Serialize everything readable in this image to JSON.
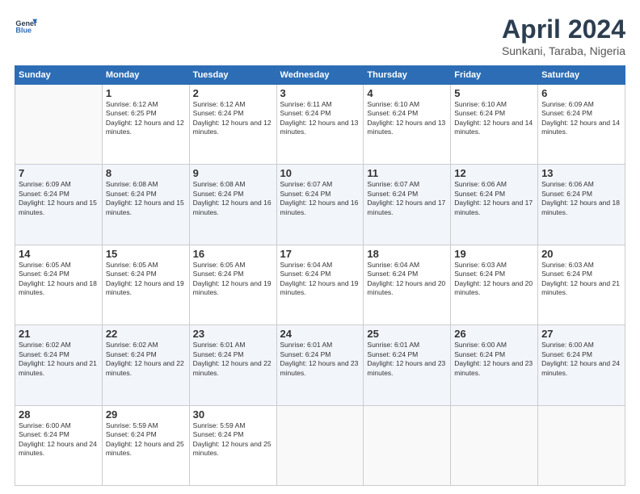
{
  "logo": {
    "text_line1": "General",
    "text_line2": "Blue"
  },
  "header": {
    "month": "April 2024",
    "location": "Sunkani, Taraba, Nigeria"
  },
  "weekdays": [
    "Sunday",
    "Monday",
    "Tuesday",
    "Wednesday",
    "Thursday",
    "Friday",
    "Saturday"
  ],
  "weeks": [
    [
      {
        "day": null
      },
      {
        "day": "1",
        "sunrise": "6:12 AM",
        "sunset": "6:25 PM",
        "daylight": "12 hours and 12 minutes."
      },
      {
        "day": "2",
        "sunrise": "6:12 AM",
        "sunset": "6:24 PM",
        "daylight": "12 hours and 12 minutes."
      },
      {
        "day": "3",
        "sunrise": "6:11 AM",
        "sunset": "6:24 PM",
        "daylight": "12 hours and 13 minutes."
      },
      {
        "day": "4",
        "sunrise": "6:10 AM",
        "sunset": "6:24 PM",
        "daylight": "12 hours and 13 minutes."
      },
      {
        "day": "5",
        "sunrise": "6:10 AM",
        "sunset": "6:24 PM",
        "daylight": "12 hours and 14 minutes."
      },
      {
        "day": "6",
        "sunrise": "6:09 AM",
        "sunset": "6:24 PM",
        "daylight": "12 hours and 14 minutes."
      }
    ],
    [
      {
        "day": "7",
        "sunrise": "6:09 AM",
        "sunset": "6:24 PM",
        "daylight": "12 hours and 15 minutes."
      },
      {
        "day": "8",
        "sunrise": "6:08 AM",
        "sunset": "6:24 PM",
        "daylight": "12 hours and 15 minutes."
      },
      {
        "day": "9",
        "sunrise": "6:08 AM",
        "sunset": "6:24 PM",
        "daylight": "12 hours and 16 minutes."
      },
      {
        "day": "10",
        "sunrise": "6:07 AM",
        "sunset": "6:24 PM",
        "daylight": "12 hours and 16 minutes."
      },
      {
        "day": "11",
        "sunrise": "6:07 AM",
        "sunset": "6:24 PM",
        "daylight": "12 hours and 17 minutes."
      },
      {
        "day": "12",
        "sunrise": "6:06 AM",
        "sunset": "6:24 PM",
        "daylight": "12 hours and 17 minutes."
      },
      {
        "day": "13",
        "sunrise": "6:06 AM",
        "sunset": "6:24 PM",
        "daylight": "12 hours and 18 minutes."
      }
    ],
    [
      {
        "day": "14",
        "sunrise": "6:05 AM",
        "sunset": "6:24 PM",
        "daylight": "12 hours and 18 minutes."
      },
      {
        "day": "15",
        "sunrise": "6:05 AM",
        "sunset": "6:24 PM",
        "daylight": "12 hours and 19 minutes."
      },
      {
        "day": "16",
        "sunrise": "6:05 AM",
        "sunset": "6:24 PM",
        "daylight": "12 hours and 19 minutes."
      },
      {
        "day": "17",
        "sunrise": "6:04 AM",
        "sunset": "6:24 PM",
        "daylight": "12 hours and 19 minutes."
      },
      {
        "day": "18",
        "sunrise": "6:04 AM",
        "sunset": "6:24 PM",
        "daylight": "12 hours and 20 minutes."
      },
      {
        "day": "19",
        "sunrise": "6:03 AM",
        "sunset": "6:24 PM",
        "daylight": "12 hours and 20 minutes."
      },
      {
        "day": "20",
        "sunrise": "6:03 AM",
        "sunset": "6:24 PM",
        "daylight": "12 hours and 21 minutes."
      }
    ],
    [
      {
        "day": "21",
        "sunrise": "6:02 AM",
        "sunset": "6:24 PM",
        "daylight": "12 hours and 21 minutes."
      },
      {
        "day": "22",
        "sunrise": "6:02 AM",
        "sunset": "6:24 PM",
        "daylight": "12 hours and 22 minutes."
      },
      {
        "day": "23",
        "sunrise": "6:01 AM",
        "sunset": "6:24 PM",
        "daylight": "12 hours and 22 minutes."
      },
      {
        "day": "24",
        "sunrise": "6:01 AM",
        "sunset": "6:24 PM",
        "daylight": "12 hours and 23 minutes."
      },
      {
        "day": "25",
        "sunrise": "6:01 AM",
        "sunset": "6:24 PM",
        "daylight": "12 hours and 23 minutes."
      },
      {
        "day": "26",
        "sunrise": "6:00 AM",
        "sunset": "6:24 PM",
        "daylight": "12 hours and 23 minutes."
      },
      {
        "day": "27",
        "sunrise": "6:00 AM",
        "sunset": "6:24 PM",
        "daylight": "12 hours and 24 minutes."
      }
    ],
    [
      {
        "day": "28",
        "sunrise": "6:00 AM",
        "sunset": "6:24 PM",
        "daylight": "12 hours and 24 minutes."
      },
      {
        "day": "29",
        "sunrise": "5:59 AM",
        "sunset": "6:24 PM",
        "daylight": "12 hours and 25 minutes."
      },
      {
        "day": "30",
        "sunrise": "5:59 AM",
        "sunset": "6:24 PM",
        "daylight": "12 hours and 25 minutes."
      },
      {
        "day": null
      },
      {
        "day": null
      },
      {
        "day": null
      },
      {
        "day": null
      }
    ]
  ]
}
